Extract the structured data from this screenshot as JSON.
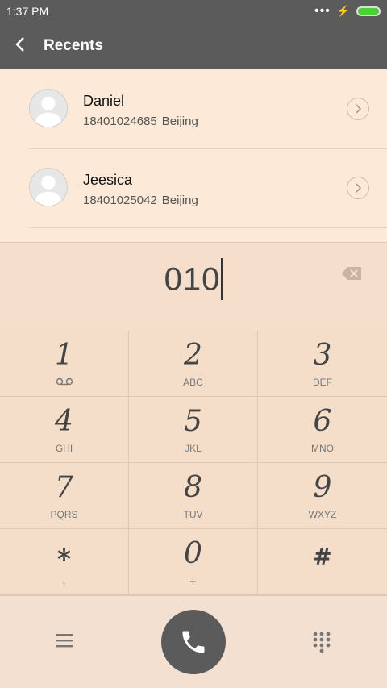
{
  "status": {
    "time": "1:37 PM"
  },
  "header": {
    "title": "Recents"
  },
  "recents": [
    {
      "name": "Daniel",
      "number": "18401024685",
      "location": "Beijing"
    },
    {
      "name": "Jeesica",
      "number": "18401025042",
      "location": "Beijing"
    }
  ],
  "dial": {
    "input": "010"
  },
  "keys": [
    {
      "digit": "1",
      "letters": ""
    },
    {
      "digit": "2",
      "letters": "ABC"
    },
    {
      "digit": "3",
      "letters": "DEF"
    },
    {
      "digit": "4",
      "letters": "GHI"
    },
    {
      "digit": "5",
      "letters": "JKL"
    },
    {
      "digit": "6",
      "letters": "MNO"
    },
    {
      "digit": "7",
      "letters": "PQRS"
    },
    {
      "digit": "8",
      "letters": "TUV"
    },
    {
      "digit": "9",
      "letters": "WXYZ"
    },
    {
      "digit": "*",
      "letters": ","
    },
    {
      "digit": "0",
      "letters": "+"
    },
    {
      "digit": "#",
      "letters": ""
    }
  ],
  "colors": {
    "bar": "#5b5b5b",
    "background": "#f3e0d0",
    "battery": "#4cd137"
  },
  "icons": {
    "back": "chevron-left-icon",
    "voicemail": "voicemail-icon",
    "backspace": "backspace-icon",
    "menu": "menu-icon",
    "call": "phone-icon",
    "keypad": "keypad-icon"
  }
}
